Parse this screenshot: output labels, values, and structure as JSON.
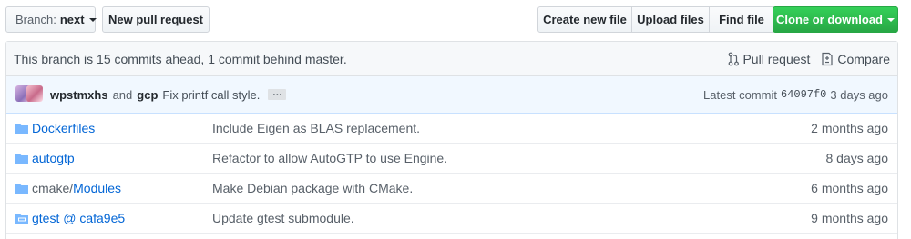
{
  "toolbar": {
    "branch_label": "Branch:",
    "branch_value": "next",
    "new_pr_label": "New pull request",
    "create_file_label": "Create new file",
    "upload_files_label": "Upload files",
    "find_file_label": "Find file",
    "clone_label": "Clone or download"
  },
  "tease": {
    "message": "This branch is 15 commits ahead, 1 commit behind master.",
    "pull_request_label": "Pull request",
    "compare_label": "Compare"
  },
  "commit": {
    "author1": "wpstmxhs",
    "and_text": "and",
    "author2": "gcp",
    "message": "Fix printf call style.",
    "ellipsis": "…",
    "latest_label": "Latest commit",
    "sha": "64097f0",
    "age": "3 days ago"
  },
  "files": [
    {
      "name": "Dockerfiles",
      "name_prefix": "",
      "message": "Include Eigen as BLAS replacement.",
      "age": "2 months ago",
      "icon": "folder-icon"
    },
    {
      "name": "autogtp",
      "name_prefix": "",
      "message": "Refactor to allow AutoGTP to use Engine.",
      "age": "8 days ago",
      "icon": "folder-icon"
    },
    {
      "name": "Modules",
      "name_prefix": "cmake/",
      "message": "Make Debian package with CMake.",
      "age": "6 months ago",
      "icon": "folder-icon"
    },
    {
      "name": "gtest @ cafa9e5",
      "name_prefix": "",
      "message": "Update gtest submodule.",
      "age": "9 months ago",
      "icon": "submodule-icon"
    }
  ],
  "colors": {
    "link": "#0366d6",
    "clone_button": "#28a745",
    "commit_bar": "#f1f8ff",
    "folder_icon": "#79b8ff"
  }
}
